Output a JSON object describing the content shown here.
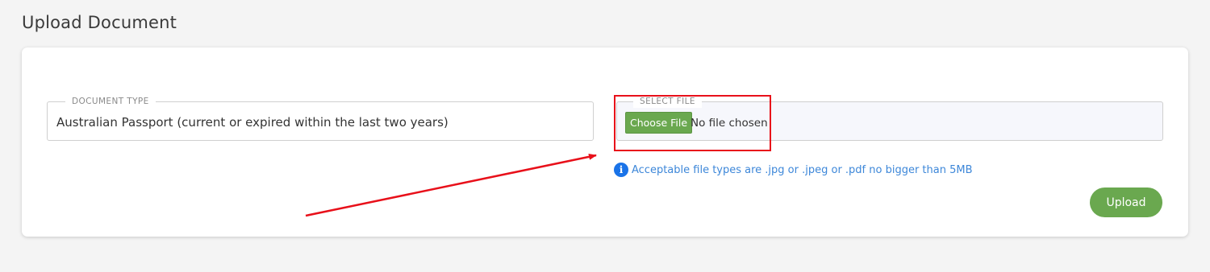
{
  "page": {
    "title": "Upload Document"
  },
  "document_type": {
    "legend": "DOCUMENT TYPE",
    "value": "Australian Passport (current or expired within the last two years)"
  },
  "select_file": {
    "legend": "SELECT FILE",
    "button_label": "Choose File",
    "status": "No file chosen"
  },
  "info": {
    "icon": "info-icon",
    "glyph": "i",
    "text": "Acceptable file types are .jpg or .jpeg or .pdf no bigger than 5MB"
  },
  "actions": {
    "upload_label": "Upload"
  },
  "colors": {
    "accent_green": "#6aa84f",
    "info_blue": "#1a73e8",
    "annotation_red": "#e8101a"
  }
}
